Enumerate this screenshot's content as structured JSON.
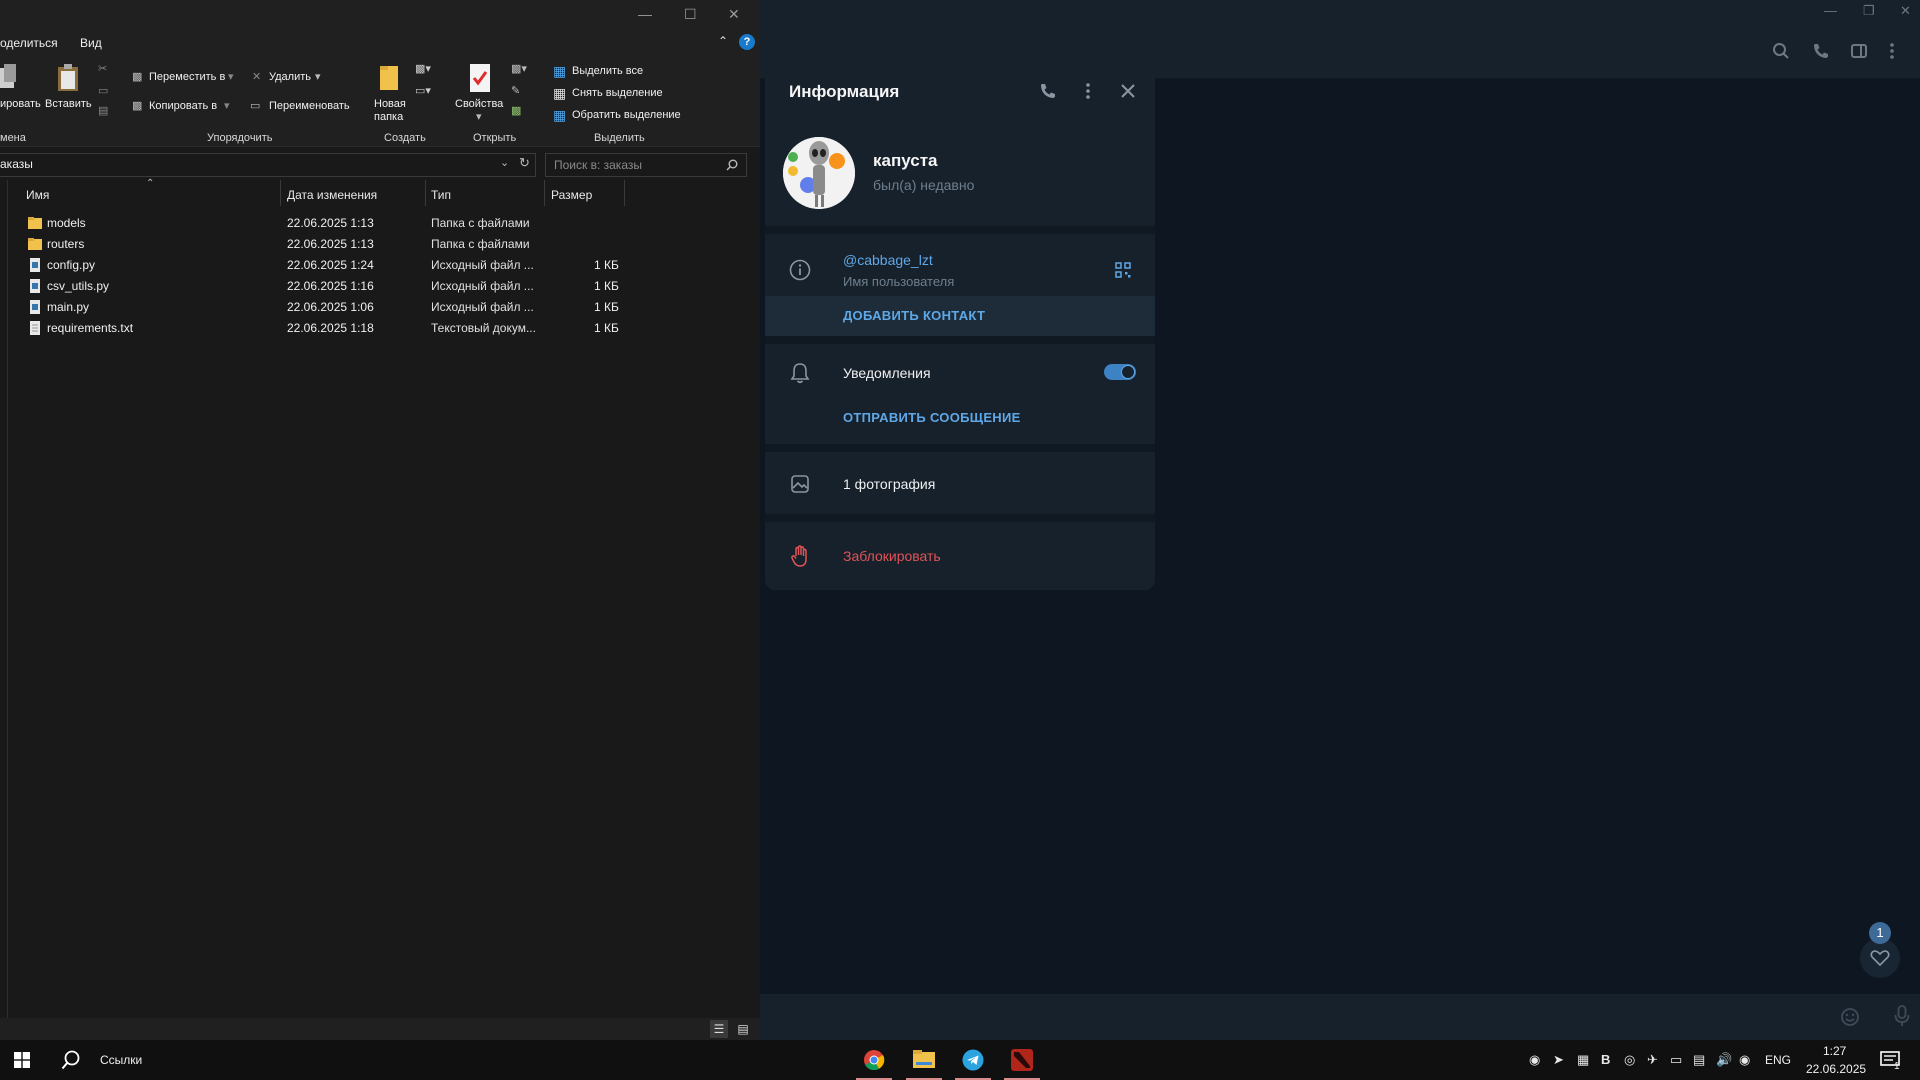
{
  "explorer": {
    "tabs": [
      "оделиться",
      "Вид"
    ],
    "ribbon": {
      "copy_path": "ировать",
      "paste": "Вставить",
      "move_to": "Переместить в",
      "copy_to": "Копировать в",
      "delete": "Удалить",
      "rename": "Переименовать",
      "new_folder_line1": "Новая",
      "new_folder_line2": "папка",
      "properties": "Свойства",
      "select_all": "Выделить все",
      "select_none": "Снять выделение",
      "invert_selection": "Обратить выделение",
      "groups": {
        "clipboard": "мена",
        "organize": "Упорядочить",
        "new": "Создать",
        "open": "Открыть",
        "select": "Выделить"
      }
    },
    "address": "аказы",
    "search_placeholder": "Поиск в: заказы",
    "columns": {
      "name": "Имя",
      "date": "Дата изменения",
      "type": "Тип",
      "size": "Размер"
    },
    "files": [
      {
        "name": "models",
        "date": "22.06.2025 1:13",
        "type": "Папка с файлами",
        "size": "",
        "kind": "folder"
      },
      {
        "name": "routers",
        "date": "22.06.2025 1:13",
        "type": "Папка с файлами",
        "size": "",
        "kind": "folder"
      },
      {
        "name": "config.py",
        "date": "22.06.2025 1:24",
        "type": "Исходный файл ...",
        "size": "1 КБ",
        "kind": "py"
      },
      {
        "name": "csv_utils.py",
        "date": "22.06.2025 1:16",
        "type": "Исходный файл ...",
        "size": "1 КБ",
        "kind": "py"
      },
      {
        "name": "main.py",
        "date": "22.06.2025 1:06",
        "type": "Исходный файл ...",
        "size": "1 КБ",
        "kind": "py"
      },
      {
        "name": "requirements.txt",
        "date": "22.06.2025 1:18",
        "type": "Текстовый докум...",
        "size": "1 КБ",
        "kind": "txt"
      }
    ]
  },
  "info_panel": {
    "title": "Информация",
    "name": "капуста",
    "status": "был(а) недавно",
    "username": "@cabbage_lzt",
    "username_caption": "Имя пользователя",
    "add_contact": "ДОБАВИТЬ КОНТАКТ",
    "notifications": "Уведомления",
    "notifications_on": true,
    "send_message": "ОТПРАВИТЬ СООБЩЕНИЕ",
    "photos": "1 фотография",
    "block": "Заблокировать"
  },
  "telegram": {
    "favorites_badge": "1"
  },
  "taskbar": {
    "search_label": "Ссылки",
    "lang": "ENG",
    "time": "1:27",
    "date": "22.06.2025",
    "notification_count": "1"
  },
  "colors": {
    "accent": "#5fa8e8",
    "danger": "#e05357",
    "panel_bg": "#17212b",
    "app_bg": "#0e1621"
  }
}
